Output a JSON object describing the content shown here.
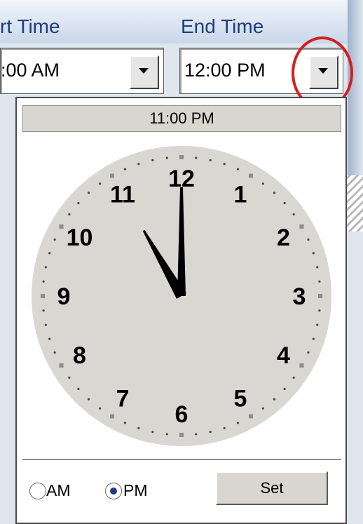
{
  "columns": {
    "start_label": "rt Time",
    "end_label": "End Time"
  },
  "start_time": {
    "value": ":00 AM"
  },
  "end_time": {
    "value": "12:00 PM"
  },
  "clock_popup": {
    "selected_time": "11:00 PM",
    "hours": [
      "12",
      "1",
      "2",
      "3",
      "4",
      "5",
      "6",
      "7",
      "8",
      "9",
      "10",
      "11"
    ],
    "hour_hand_value": 11,
    "minute_hand_value": 0,
    "am_label": "AM",
    "pm_label": "PM",
    "selected_period": "PM",
    "set_label": "Set"
  },
  "icons": {
    "dropdown": "chevron-down-icon"
  },
  "colors": {
    "header_text": "#1f3e7a",
    "clock_face": "#d9d7d2",
    "highlight": "#d22020"
  }
}
